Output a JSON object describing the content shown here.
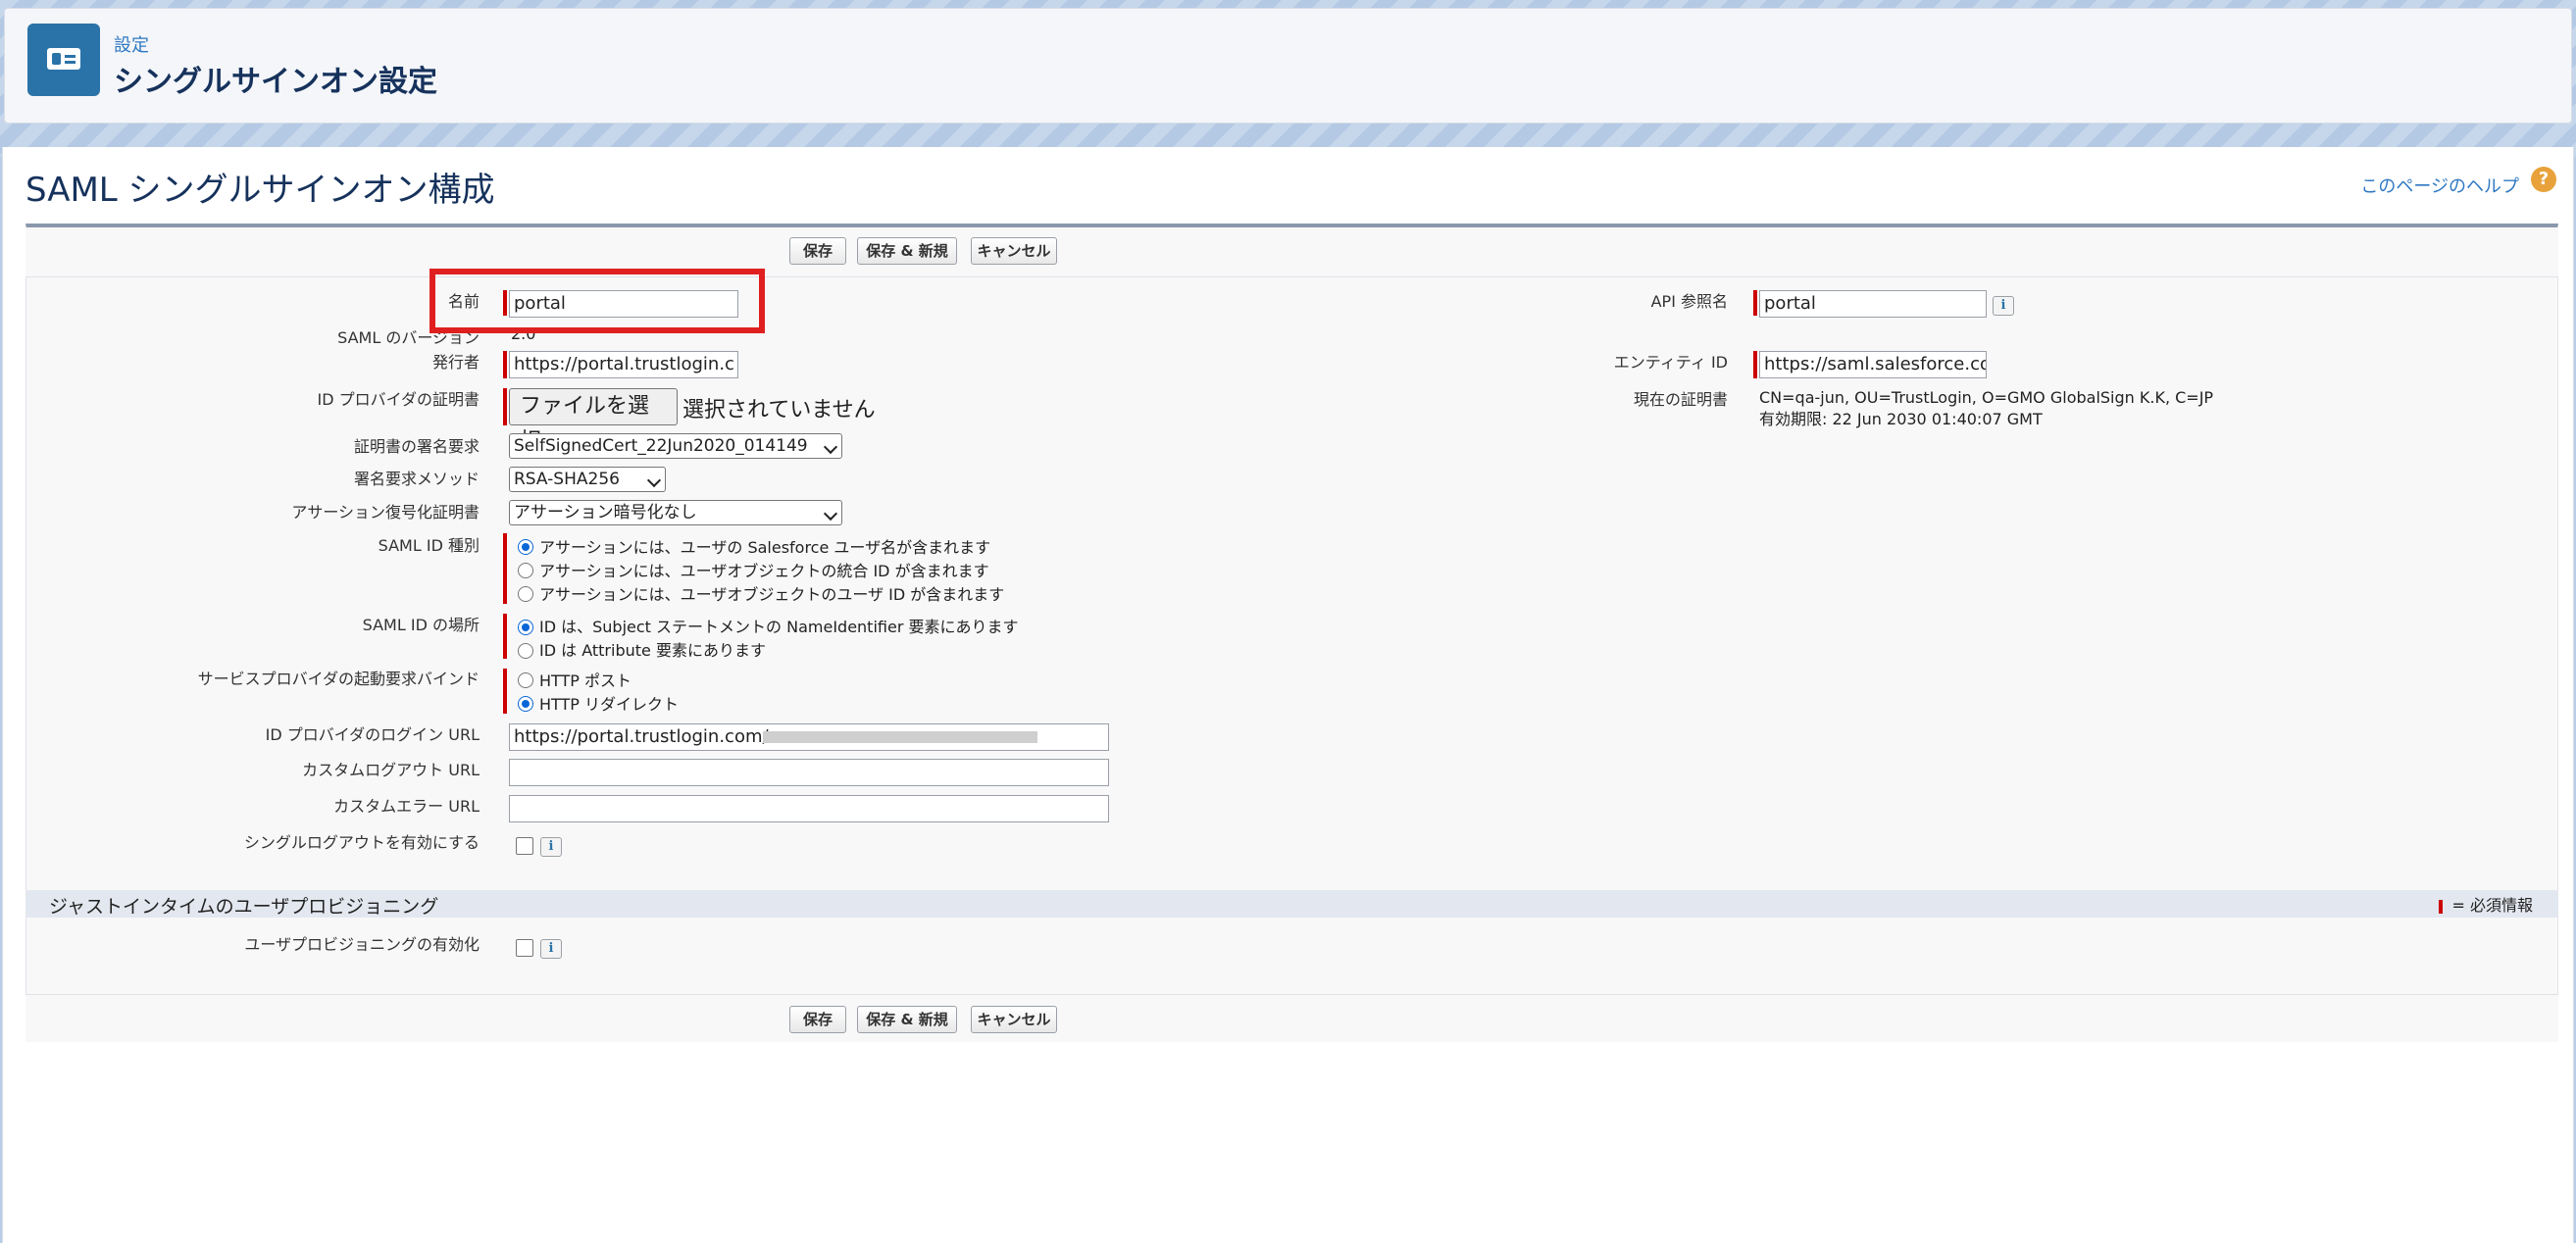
{
  "header": {
    "breadcrumb": "設定",
    "title": "シングルサインオン設定",
    "icon": "id-card-icon"
  },
  "section": {
    "title": "SAML シングルサインオン構成",
    "help_link": "このページのヘルプ",
    "help_icon": "?"
  },
  "buttons": {
    "save": "保存",
    "save_new": "保存 & 新規",
    "cancel": "キャンセル"
  },
  "fields": {
    "name": {
      "label": "名前",
      "value": "portal"
    },
    "saml_version": {
      "label": "SAML のバージョン",
      "value": "2.0"
    },
    "issuer": {
      "label": "発行者",
      "value": "https://portal.trustlogin.c"
    },
    "idp_cert": {
      "label": "ID プロバイダの証明書",
      "button": "ファイルを選択",
      "status": "選択されていません"
    },
    "cert_signing": {
      "label": "証明書の署名要求",
      "value": "SelfSignedCert_22Jun2020_014149"
    },
    "sign_method": {
      "label": "署名要求メソッド",
      "value": "RSA-SHA256"
    },
    "assertion_decrypt": {
      "label": "アサーション復号化証明書",
      "value": "アサーション暗号化なし"
    },
    "saml_id_type": {
      "label": "SAML ID 種別",
      "options": [
        "アサーションには、ユーザの Salesforce ユーザ名が含まれます",
        "アサーションには、ユーザオブジェクトの統合 ID が含まれます",
        "アサーションには、ユーザオブジェクトのユーザ ID が含まれます"
      ]
    },
    "saml_id_location": {
      "label": "SAML ID の場所",
      "options": [
        "ID は、Subject ステートメントの NameIdentifier 要素にあります",
        "ID は Attribute 要素にあります"
      ]
    },
    "sp_binding": {
      "label": "サービスプロバイダの起動要求バインド",
      "options": [
        "HTTP ポスト",
        "HTTP リダイレクト"
      ]
    },
    "idp_login_url": {
      "label": "ID プロバイダのログイン URL",
      "value": "https://portal.trustlogin.com/"
    },
    "custom_logout_url": {
      "label": "カスタムログアウト URL",
      "value": ""
    },
    "custom_error_url": {
      "label": "カスタムエラー URL",
      "value": ""
    },
    "single_logout": {
      "label": "シングルログアウトを有効にする"
    },
    "api_name": {
      "label": "API 参照名",
      "value": "portal"
    },
    "entity_id": {
      "label": "エンティティ ID",
      "value": "https://saml.salesforce.co"
    },
    "current_cert": {
      "label": "現在の証明書",
      "line1": "CN=qa-jun, OU=TrustLogin, O=GMO GlobalSign K.K, C=JP",
      "line2": "有効期限: 22 Jun 2030 01:40:07 GMT"
    }
  },
  "jit": {
    "title": "ジャストインタイムのユーザプロビジョニング",
    "required_legend": "= 必須情報",
    "enable_label": "ユーザプロビジョニングの有効化"
  },
  "info_icon": "i",
  "colors": {
    "brand": "#2a73a8",
    "required": "#cc0000",
    "highlight": "#e02020",
    "link": "#2e78c2"
  }
}
